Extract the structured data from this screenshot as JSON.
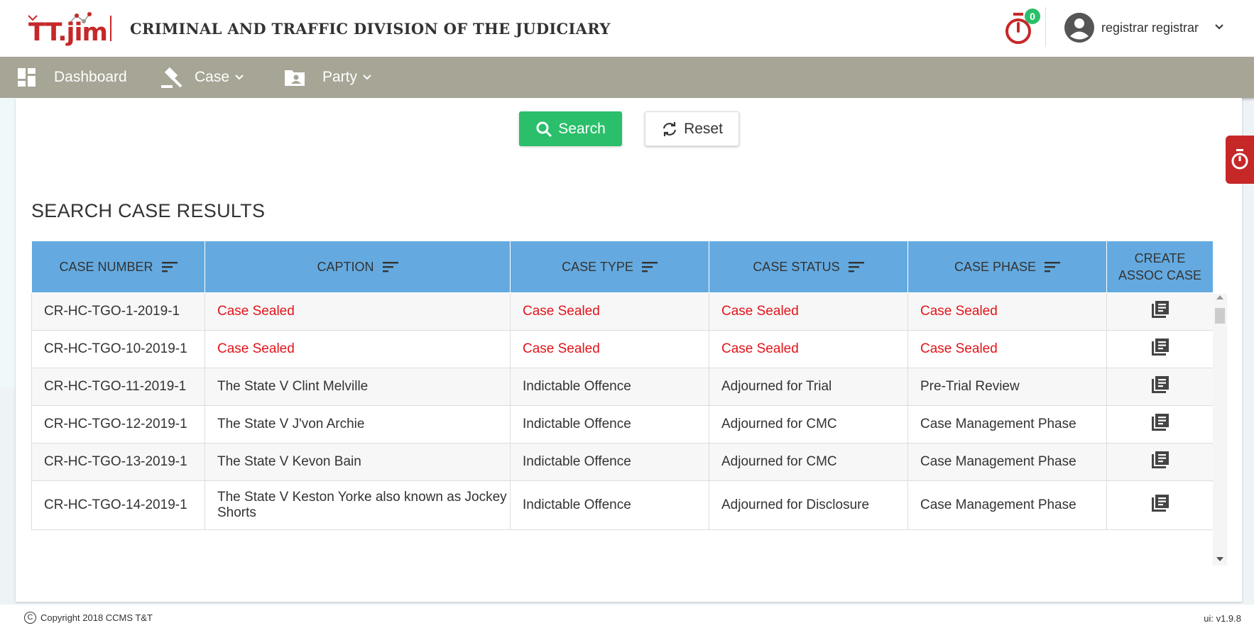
{
  "header": {
    "logo_text": "TT.jim",
    "title": "CRIMINAL AND TRAFFIC DIVISION OF THE JUDICIARY",
    "timer_count": "0",
    "user_name": "registrar registrar"
  },
  "nav": {
    "dashboard": "Dashboard",
    "case": "Case",
    "party": "Party"
  },
  "actions": {
    "search_label": "Search",
    "reset_label": "Reset"
  },
  "results": {
    "title": "SEARCH CASE RESULTS",
    "columns": [
      "CASE NUMBER",
      "CAPTION",
      "CASE TYPE",
      "CASE STATUS",
      "CASE PHASE"
    ],
    "last_column_line1": "CREATE",
    "last_column_line2": "ASSOC CASE",
    "rows": [
      {
        "case_number": "CR-HC-TGO-1-2019-1",
        "caption": "Case Sealed",
        "case_type": "Case Sealed",
        "case_status": "Case Sealed",
        "case_phase": "Case Sealed",
        "sealed": true
      },
      {
        "case_number": "CR-HC-TGO-10-2019-1",
        "caption": "Case Sealed",
        "case_type": "Case Sealed",
        "case_status": "Case Sealed",
        "case_phase": "Case Sealed",
        "sealed": true
      },
      {
        "case_number": "CR-HC-TGO-11-2019-1",
        "caption": "The State V Clint Melville",
        "case_type": "Indictable Offence",
        "case_status": "Adjourned for Trial",
        "case_phase": "Pre-Trial Review",
        "sealed": false
      },
      {
        "case_number": "CR-HC-TGO-12-2019-1",
        "caption": "The State V J'von Archie",
        "case_type": "Indictable Offence",
        "case_status": "Adjourned for CMC",
        "case_phase": "Case Management Phase",
        "sealed": false
      },
      {
        "case_number": "CR-HC-TGO-13-2019-1",
        "caption": "The State V Kevon Bain",
        "case_type": "Indictable Offence",
        "case_status": "Adjourned for CMC",
        "case_phase": "Case Management Phase",
        "sealed": false
      },
      {
        "case_number": "CR-HC-TGO-14-2019-1",
        "caption": "The State V Keston Yorke also known as Jockey Shorts",
        "case_type": "Indictable Offence",
        "case_status": "Adjourned for Disclosure",
        "case_phase": "Case Management Phase",
        "sealed": false
      }
    ]
  },
  "footer": {
    "copyright_symbol": "C",
    "copyright": "Copyright 2018  CCMS T&T",
    "version": "ui: v1.9.8"
  },
  "colors": {
    "brand_red": "#c62828",
    "nav_bg": "#a6a596",
    "table_header": "#64aae0",
    "search_green": "#2bbf6b",
    "sealed_red": "#e3141a"
  },
  "icons": [
    "timer-icon",
    "user-avatar-icon",
    "chevron-down-icon",
    "dashboard-icon",
    "gavel-icon",
    "party-folder-icon",
    "search-icon",
    "refresh-icon",
    "sort-icon",
    "library-books-icon"
  ]
}
